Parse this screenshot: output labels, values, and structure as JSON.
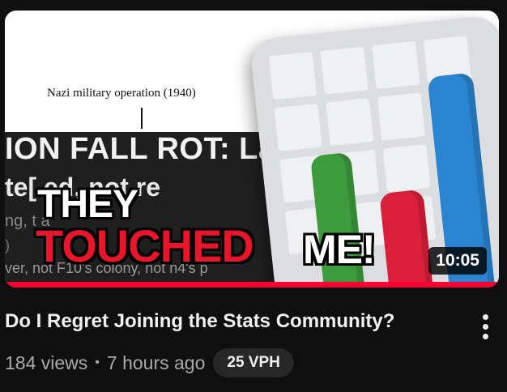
{
  "thumbnail": {
    "caption": "Nazi military operation (1940)",
    "background_lines": [
      "ION FALL ROT: La",
      "te[ ed, not re",
      "ng,   t   a  ",
      ")",
      "ver, not F10's colony, not n4's p"
    ],
    "overlay_top": "THEY",
    "overlay_bottom": "TOUCHED",
    "overlay_end": "ME!",
    "duration": "10:05",
    "chart_icon": "bar-chart-icon",
    "colors": {
      "overlay_red": "#e8162b",
      "progress_red": "#ff0033",
      "bar_green": "#3d9a3d",
      "bar_red": "#d91f3a",
      "bar_blue": "#2a84cf"
    }
  },
  "video": {
    "title": "Do I Regret Joining the Stats Community?",
    "views": "184 views",
    "separator": "•",
    "age": "7 hours ago",
    "vph_badge": "25 VPH"
  },
  "menu": {
    "icon": "more-vertical-icon"
  }
}
